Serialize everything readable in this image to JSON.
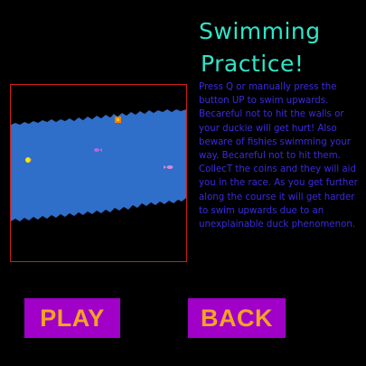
{
  "title": {
    "line1": "Swimming",
    "line2": "Practice!"
  },
  "instructions": "Press Q or manually press the button UP to swim upwards. Becareful not to hit the walls or your duckie will get hurt! Also beware of fishies swimming your way. Becareful not to hit them. CollecT the coins and they will aid you in the race. As you get further along the course it will get harder to swim upwards due to an unexplainable duck phenomenon.",
  "buttons": {
    "play": "PLAY",
    "back": "BACK"
  },
  "colors": {
    "background": "#000000",
    "title": "#2fe6c8",
    "instructions": "#3b2bdc",
    "button_bg": "#a000c8",
    "button_text": "#f2a423",
    "preview_border": "#d11c1c",
    "water": "#2f6ec9"
  },
  "preview_sprites": {
    "duck": "duck-icon",
    "coin": "coin-icon",
    "fish": "fish-icon",
    "obstacle": "obstacle-icon"
  }
}
